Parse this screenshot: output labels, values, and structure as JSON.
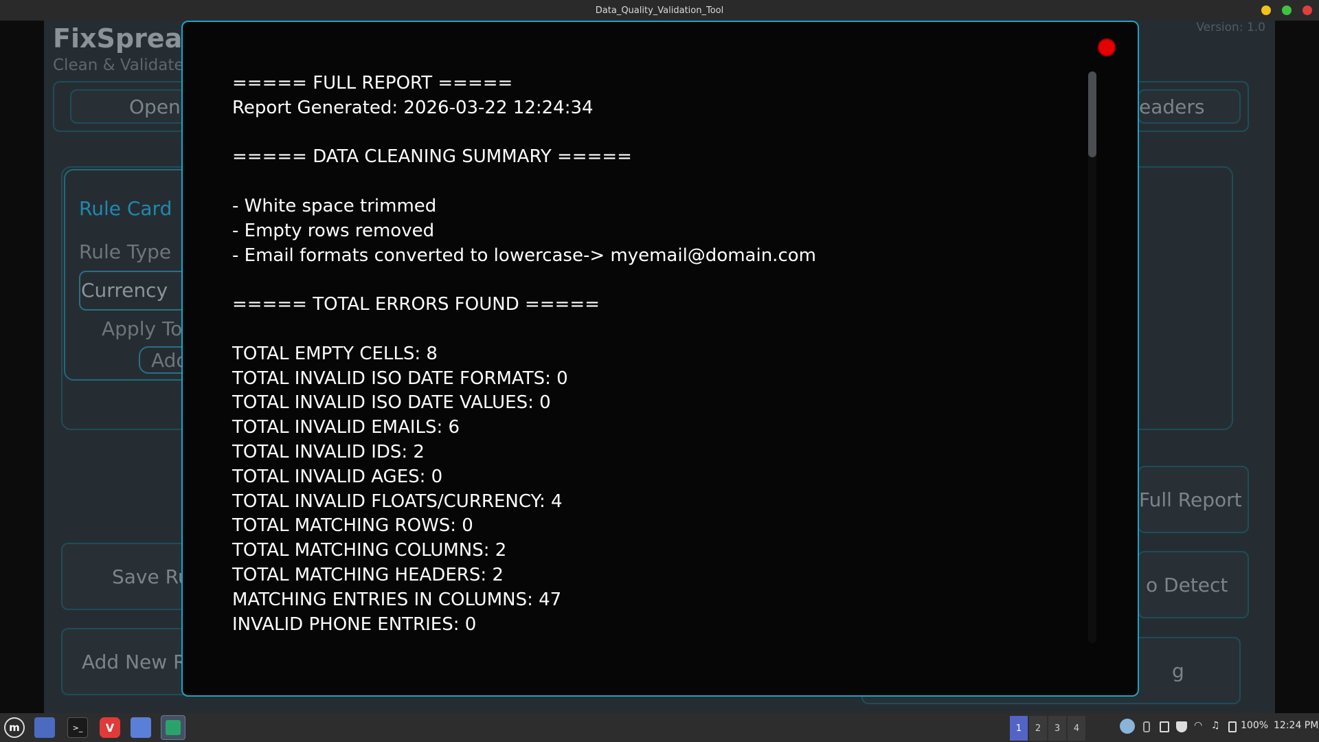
{
  "window": {
    "title": "Data_Quality_Validation_Tool"
  },
  "app": {
    "name": "FixSpread",
    "subtitle": "Clean & Validate",
    "version": "Version: 1.0",
    "buttons": {
      "open": "Open",
      "headers": "eaders",
      "full_report": "Full Report",
      "auto_detect": "o Detect",
      "save_rules": "Save Rul",
      "add_new_rule": "Add New Ru",
      "add": "Add",
      "bottom_right": "g"
    },
    "rule_card": {
      "title": "Rule Card",
      "rule_type_label": "Rule Type",
      "rule_type_value": "Currency",
      "apply_to_label": "Apply To V"
    }
  },
  "report": {
    "lines": [
      "===== FULL REPORT =====",
      "Report Generated: 2026-03-22 12:24:34",
      "",
      "===== DATA CLEANING SUMMARY =====",
      "",
      "- White space trimmed",
      "- Empty rows removed",
      "- Email formats converted to lowercase-> myemail@domain.com",
      "",
      "===== TOTAL ERRORS FOUND =====",
      "",
      "TOTAL EMPTY CELLS: 8",
      "TOTAL INVALID ISO DATE FORMATS: 0",
      "TOTAL INVALID ISO DATE VALUES: 0",
      "TOTAL INVALID EMAILS: 6",
      "TOTAL INVALID IDS: 2",
      "TOTAL INVALID AGES: 0",
      "TOTAL INVALID FLOATS/CURRENCY: 4",
      "TOTAL MATCHING ROWS: 0",
      "TOTAL MATCHING COLUMNS: 2",
      "TOTAL MATCHING HEADERS: 2",
      "MATCHING ENTRIES IN COLUMNS: 47",
      "INVALID PHONE ENTRIES: 0"
    ]
  },
  "taskbar": {
    "workspaces": [
      "1",
      "2",
      "3",
      "4"
    ],
    "active_workspace": "1",
    "battery": "100%",
    "clock": "12:24 PM",
    "icons": [
      "menu-icon",
      "folder-icon",
      "terminal-icon",
      "vivaldi-icon",
      "files-icon",
      "app-icon"
    ]
  }
}
